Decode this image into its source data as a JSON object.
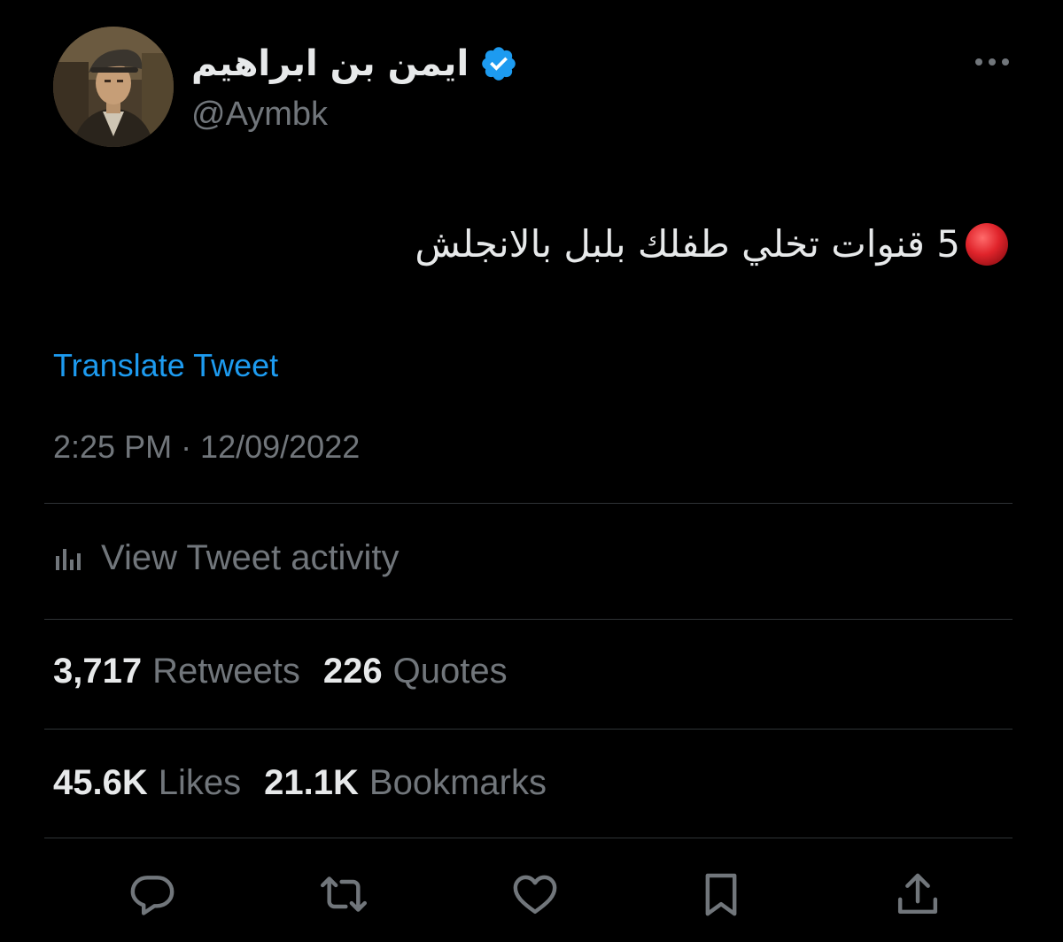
{
  "author": {
    "display_name": "ايمن بن ابراهيم",
    "handle": "@Aymbk",
    "verified": true,
    "avatar_icon": "profile-photo"
  },
  "tweet": {
    "text": "5 قنوات تخلي طفلك بلبل بالانجلش",
    "leading_emoji": "red-circle-icon",
    "translate_label": "Translate Tweet",
    "timestamp": "2:25 PM · 12/09/2022"
  },
  "activity": {
    "label": "View Tweet activity",
    "icon": "analytics-icon"
  },
  "stats": {
    "retweets": {
      "value": "3,717",
      "label": "Retweets"
    },
    "quotes": {
      "value": "226",
      "label": "Quotes"
    },
    "likes": {
      "value": "45.6K",
      "label": "Likes"
    },
    "bookmarks": {
      "value": "21.1K",
      "label": "Bookmarks"
    }
  },
  "actions": [
    "reply-icon",
    "retweet-icon",
    "like-icon",
    "bookmark-icon",
    "share-icon"
  ],
  "colors": {
    "background": "#000000",
    "text_primary": "#e7e9ea",
    "text_secondary": "#71767b",
    "link": "#1d9bf0",
    "divider": "#2f3336",
    "verified": "#1d9bf0",
    "red_circle": "#e0242b"
  }
}
